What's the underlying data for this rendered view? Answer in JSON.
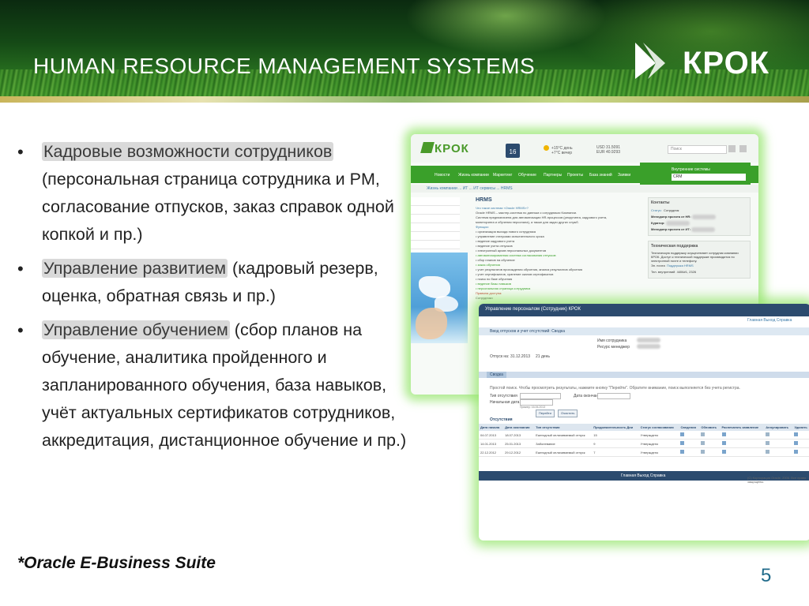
{
  "header": {
    "title": "HUMAN RESOURCE MANAGEMENT SYSTEMS",
    "logo_text": "КРОК"
  },
  "bullets": [
    {
      "highlight": "Кадровые возможности сотрудников",
      "text": " (персональная страница сотрудника и PM, согласование отпусков, заказ справок одной копкой и пр.)"
    },
    {
      "highlight": "Управление развитием",
      "text": " (кадровый резерв, оценка, обратная связь и пр.)"
    },
    {
      "highlight": "Управление обучением",
      "text": " (сбор планов на обучение, аналитика пройденного и запланированного обучения, база навыков,  учёт актуальных сертификатов сотрудников, аккредитация, дистанционное обучение и пр.)"
    }
  ],
  "footnote": "*Oracle E-Business Suite",
  "page_number": "5",
  "portal": {
    "logo": "КРОК",
    "date": "16",
    "weather_line1": "+15°C день",
    "weather_line2": "+7°C вечер",
    "phone1": "USD 31.5091",
    "phone2": "EUR 40.9293",
    "search_placeholder": "Поиск",
    "nav": [
      "Новости",
      "Жизнь компании",
      "Маркетинг",
      "Обучение",
      "Партнеры",
      "Проекты",
      "База знаний",
      "Заявки"
    ],
    "systems_label": "Внутренние системы",
    "systems_value": "CRM",
    "breadcrumb": "Жизнь компании ... ИТ ... ИТ сервисы ... HRMS",
    "left_menu": [
      "",
      "",
      "",
      "",
      "",
      ""
    ],
    "main_heading": "HRMS",
    "main_lines": [
      "Что такое система «Oracle HRMS»?",
      "Oracle HRMS – мастер-система по данным о сотрудниках Компании.",
      "Система предназначена для автоматизации HR-процессов (рекрутинга, кадрового учета,",
      "мониторинга и обучения персонала), а также для задач других служб.",
      "Функции:",
      "• организация выхода нового сотрудника",
      "• управление статусами испытательного срока",
      "• ведение кадрового учета",
      "• ведение учета отпусков",
      "• электронный архив персональных документов",
      "• автоматизированная система согласования отпусков",
      "• сбор планов на обучение",
      "• заказ обучения",
      "• учет результатов прохождения обучения, анализ результатов обучения",
      "• учет сертификатов, хранение сканов сертификатов",
      "• поиск по базе обучения",
      "• ведение базы навыков",
      "• персональная страница сотрудника",
      "Правила доступа:",
      "Сотрудники"
    ],
    "contacts_title": "Контакты",
    "contacts_rows": [
      {
        "label": "Статус:",
        "value": "Сотрудник"
      },
      {
        "label": "Менеджер проекта от HR:",
        "value": ""
      },
      {
        "label": "Куратор:",
        "value": ""
      },
      {
        "label": "Менеджер проекта от ИТ:",
        "value": ""
      }
    ],
    "support_title": "Техническая поддержка",
    "support_text": "Техническую поддержку осуществляет сотрудник компании КРОК. Доступ к технической поддержке производится по электронной почте и телефону.",
    "support_rows": [
      {
        "label": "Эл. почта",
        "value": "Поддержка HRMS"
      },
      {
        "label": "Тел. внутренний",
        "value": "4406#1, 2326"
      }
    ]
  },
  "absence": {
    "title": "Управление персоналом (Сотрудник) КРОК",
    "links": "Главная   Выход   Справка",
    "strip": "Ввод отпусков и учет отсутствий: Сводка",
    "name_label": "Имя сотрудника",
    "manager_label": "Ресурс менеджер",
    "date_label": "Отпуск на:",
    "date_value": "31.12.2013",
    "days_value": "21 день",
    "tab": "Сводка",
    "hint": "Простой поиск. Чтобы просмотреть результаты, нажмите кнопку \"Перейти\". Обратите внимание, поиск выполняется без учета регистра.",
    "type_label": "Тип отсутствия",
    "start_label": "Начальная дата",
    "end_label": "Дата окончания",
    "example": "Пример: 16.06.2013",
    "btn_go": "Перейти",
    "btn_clear": "Очистить",
    "section": "Отсутствия",
    "table_headers": [
      "Дата начала",
      "Дата окончания",
      "Тип отсутствия",
      "Продолжительность Дни",
      "Статус согласования",
      "Сведения",
      "Обновить",
      "Распечатать заявление",
      "Аннулировать",
      "Удалить"
    ],
    "rows": [
      {
        "start": "04.07.2013",
        "end": "18.07.2013",
        "type": "Ежегодный оплачиваемый отпуск",
        "days": "15",
        "status": "Утверждено"
      },
      {
        "start": "14.01.2013",
        "end": "25.01.2013",
        "type": "Заболевание",
        "days": "9",
        "status": "Утверждено"
      },
      {
        "start": "22.12.2012",
        "end": "29.12.2012",
        "type": "Ежегодный оплачиваемый отпуск",
        "days": "7",
        "status": "Утверждено"
      }
    ],
    "bottom_links": "Главная   Выход   Справка",
    "copyright": "(C) Корпорация Oracle, 2006. Все права защищены."
  }
}
